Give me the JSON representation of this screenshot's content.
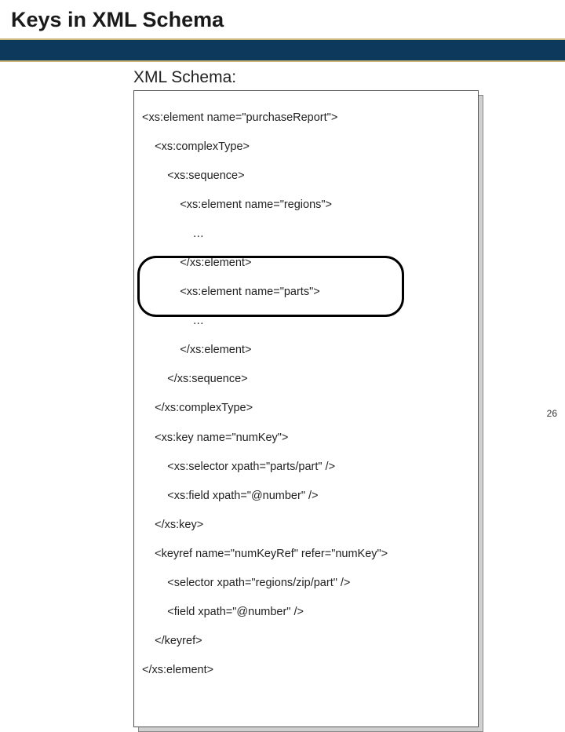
{
  "slide": {
    "title": "Keys in XML Schema",
    "subtitle": "XML Schema:",
    "page_number": "26"
  },
  "code": {
    "l1": "<xs:element name=\"purchaseReport\">",
    "l2": "    <xs:complexType>",
    "l3": "        <xs:sequence>",
    "l4": "            <xs:element name=\"regions\">",
    "l5": "                …",
    "l6": "            </xs:element>",
    "l7": "            <xs:element name=\"parts\">",
    "l8": "                …",
    "l9": "            </xs:element>",
    "l10": "        </xs:sequence>",
    "l11": "    </xs:complexType>",
    "l12": "    <xs:key name=\"numKey\">",
    "l13": "        <xs:selector xpath=\"parts/part\" />",
    "l14": "        <xs:field xpath=\"@number\" />",
    "l15": "    </xs:key>",
    "l16": "    <keyref name=\"numKeyRef\" refer=\"numKey\">",
    "l17": "        <selector xpath=\"regions/zip/part\" />",
    "l18": "        <field xpath=\"@number\" />",
    "l19": "    </keyref>",
    "l20": "</xs:element>"
  }
}
